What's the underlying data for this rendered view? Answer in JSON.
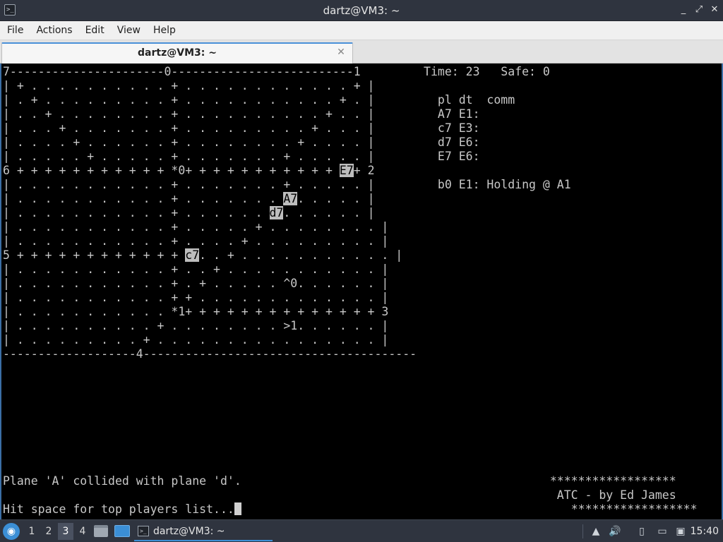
{
  "window": {
    "title": "dartz@VM3: ~",
    "icon": "terminal-icon",
    "controls": {
      "minimize": "_",
      "maximize": "⤢",
      "close": "✕"
    }
  },
  "menubar": {
    "items": [
      "File",
      "Actions",
      "Edit",
      "View",
      "Help"
    ]
  },
  "tab": {
    "label": "dartz@VM3: ~",
    "close": "✕"
  },
  "terminal": {
    "lines": [
      "7----------------------0--------------------------1         Time: 23   Safe: 0",
      "| + . . . . . . . . . . + . . . . . . . . . . . . + |",
      "| . + . . . . . . . . . + . . . . . . . . . . . + . |         pl dt  comm",
      "| . . + . . . . . . . . + . . . . . . . . . . + . . |         A7 E1:",
      "| . . . + . . . . . . . + . . . . . . . . . + . . . |         c7 E3:",
      "| . . . . + . . . . . . + . . . . . . . . + . . . . |         d7 E6:",
      "| . . . . . + . . . . . + . . . . . . . + . . . . . |         E7 E6:",
      "6 + + + + + + + + + + + *0+ + + + + + + + + + + [E7]+ 2",
      "| . . . . . . . . . . . + . . . . . . . + . . . . . |         b0 E1: Holding @ A1",
      "| . . . . . . . . . . . + . . . . . . . [A7]. . . . . |",
      "| . . . . . . . . . . . + . . . . . . [d7]. . . . . . |",
      "| . . . . . . . . . . . + . . . . . + . . . . . . . . |",
      "| . . . . . . . . . . . + . . . . + . . . . . . . . . |",
      "5 + + + + + + + + + + + + [c7]. . + . . . . . . . . . . . |",
      "| . . . . . . . . . . . + . . + . . . . . . . . . . . |",
      "| . . . . . . . . . . . + . + . . . . . ^0. . . . . . |",
      "| . . . . . . . . . . . + + . . . . . . . . . . . . . |",
      "| . . . . . . . . . . . *1+ + + + + + + + + + + + + + 3",
      "| . . . . . . . . . . + . . . . . . . . >1. . . . . . |",
      "| . . . . . . . . . + . . . . . . . . . . . . . . . . |",
      "-------------------4---------------------------------------",
      "",
      "",
      "",
      "",
      "",
      "",
      "",
      "",
      "Plane 'A' collided with plane 'd'.                                            ******************",
      "                                                                               ATC - by Ed James",
      "Hit space for top players list...[CURSOR]                                               ******************"
    ]
  },
  "taskbar": {
    "workspaces": [
      "1",
      "2",
      "3",
      "4"
    ],
    "active_workspace": "3",
    "task_label": "dartz@VM3: ~",
    "clock": "15:40"
  }
}
